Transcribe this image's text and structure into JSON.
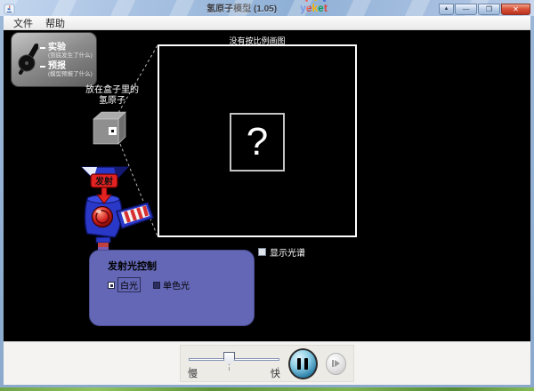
{
  "window": {
    "title": "氢原子模型 (1.05)",
    "logo_letters": [
      {
        "ch": "y",
        "color": "#4a74d8"
      },
      {
        "ch": "e",
        "color": "#db4437"
      },
      {
        "ch": "k",
        "color": "#f4b400"
      },
      {
        "ch": "e",
        "color": "#0f9d58"
      },
      {
        "ch": "t",
        "color": "#db4437"
      }
    ],
    "buttons": {
      "helper": "▲",
      "minimize": "—",
      "maximize": "❐",
      "close": "✕"
    }
  },
  "menu": {
    "file": "文件",
    "help": "帮助"
  },
  "mode_switch": {
    "experiment_label": "实验",
    "experiment_sub": "(到底发生了什么)",
    "prediction_label": "预报",
    "prediction_sub": "(模型预报了什么)"
  },
  "atom_box": {
    "label_line1": "放在盒子里的",
    "label_line2": "氢原子"
  },
  "gun": {
    "fire_label": "发射"
  },
  "viewport": {
    "title": "没有按比例画图",
    "placeholder": "?"
  },
  "spectrum": {
    "checkbox_label": "显示光谱",
    "checked": false
  },
  "light_control": {
    "title": "发射光控制",
    "options": [
      {
        "label": "白光",
        "selected": true
      },
      {
        "label": "单色光",
        "selected": false
      }
    ]
  },
  "clock": {
    "slow_label": "慢",
    "fast_label": "快",
    "state": "running"
  },
  "colors": {
    "canvas": "#000000",
    "light_panel": "#6467b6",
    "gun_blue": "#2a38c8",
    "gun_red": "#e32222",
    "titlebar": "#a9c2e2",
    "close_button": "#c8402c"
  }
}
